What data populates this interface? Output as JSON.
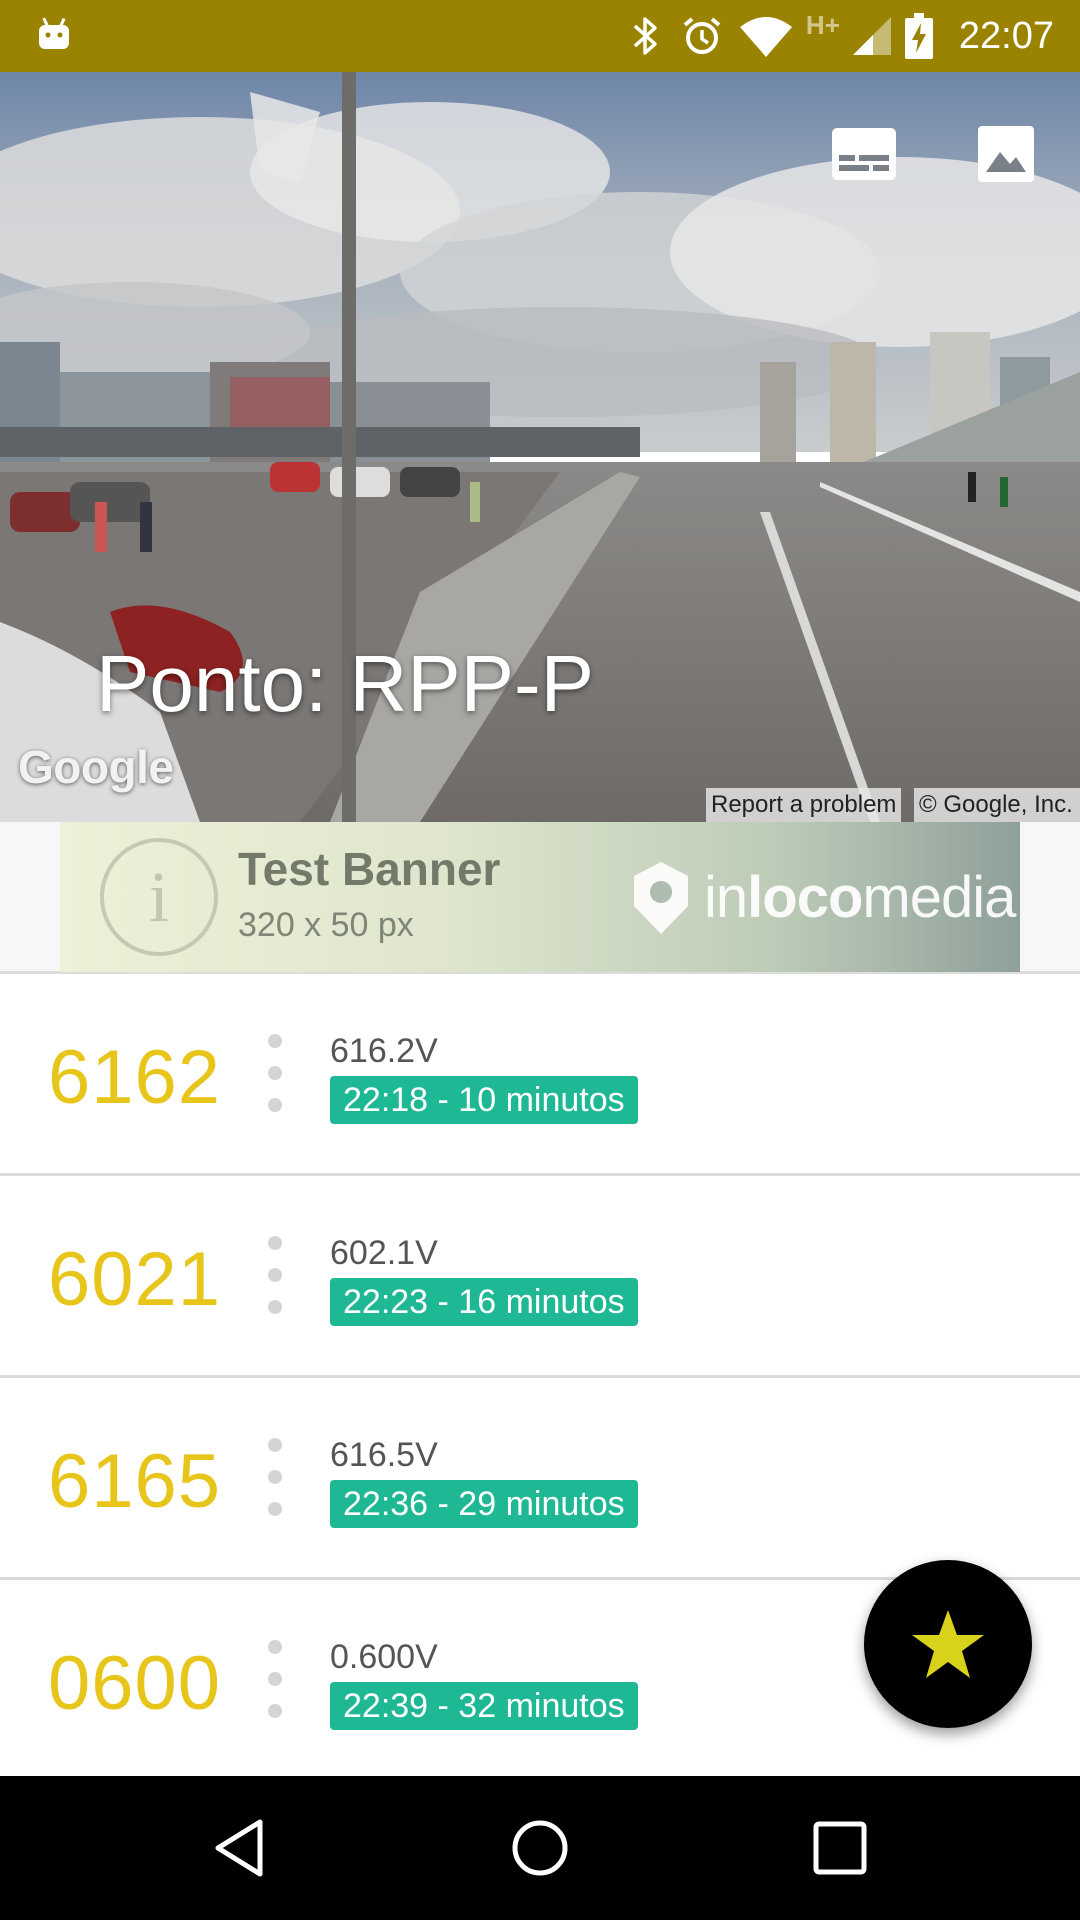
{
  "status_bar": {
    "time": "22:07",
    "network_label": "H+",
    "icons": [
      "android-debug-icon",
      "bluetooth-icon",
      "alarm-icon",
      "wifi-icon",
      "cell-signal-icon",
      "battery-charging-icon"
    ],
    "background_color": "#9a8300"
  },
  "hero": {
    "title": "Ponto: RPP-P",
    "google_logo": "Google",
    "report_link": "Report a problem",
    "copyright": "© Google, Inc.",
    "buttons": [
      "captions-icon",
      "photo-icon"
    ]
  },
  "banner": {
    "title": "Test Banner",
    "subtitle": "320 x 50 px",
    "brand_prefix": "in",
    "brand_bold": "loco",
    "brand_suffix": "media"
  },
  "arrivals": [
    {
      "code": "6162",
      "voltage": "616.2V",
      "time": "22:18 - 10 minutos"
    },
    {
      "code": "6021",
      "voltage": "602.1V",
      "time": "22:23 - 16 minutos"
    },
    {
      "code": "6165",
      "voltage": "616.5V",
      "time": "22:36 - 29 minutos"
    },
    {
      "code": "0600",
      "voltage": "0.600V",
      "time": "22:39 - 32 minutos"
    }
  ],
  "colors": {
    "code": "#e8c51a",
    "badge": "#1eb895",
    "fab_star": "#d9d21a"
  },
  "fab": {
    "icon": "star-icon"
  },
  "nav_bar": {
    "icons": [
      "back-icon",
      "home-icon",
      "recents-icon"
    ]
  }
}
